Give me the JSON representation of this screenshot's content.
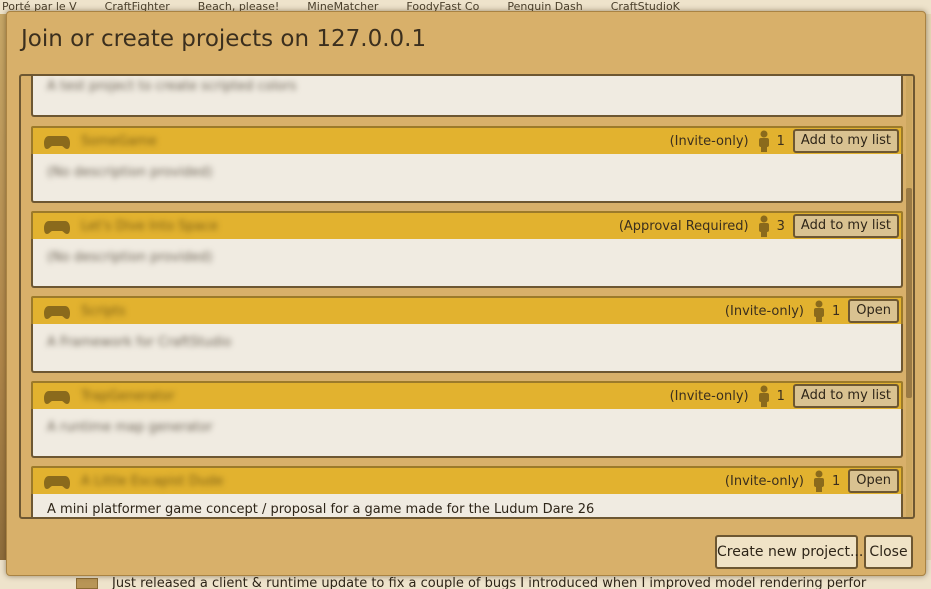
{
  "background": {
    "tabs": [
      "Porté par le V",
      "CraftFighter",
      "Beach, please!",
      "MineMatcher",
      "FoodyFast Co",
      "Penguin Dash",
      "CraftStudioK"
    ],
    "footer_text": "Just released a client & runtime update to fix a couple of bugs I introduced when I improved model rendering perfor"
  },
  "dialog": {
    "title": "Join or create projects on 127.0.0.1",
    "create_button": "Create new project...",
    "close_button": "Close"
  },
  "projects": [
    {
      "name": "",
      "description": "A test project to create scripted colors",
      "access": "",
      "members": "",
      "action": "",
      "partial": "top"
    },
    {
      "name": "SomeGame",
      "description": "(No description provided)",
      "access": "(Invite-only)",
      "members": "1",
      "action": "Add to my list"
    },
    {
      "name": "Let's Dive Into Space",
      "description": "(No description provided)",
      "access": "(Approval Required)",
      "members": "3",
      "action": "Add to my list"
    },
    {
      "name": "Scripts",
      "description": "A Framework for CraftStudio",
      "access": "(Invite-only)",
      "members": "1",
      "action": "Open"
    },
    {
      "name": "TrapGenerator",
      "description": "A runtime map generator",
      "access": "(Invite-only)",
      "members": "1",
      "action": "Add to my list"
    },
    {
      "name": "A Little Escapist Dude",
      "description": "A mini platformer game concept / proposal for a game made for the Ludum Dare 26",
      "access": "(Invite-only)",
      "members": "1",
      "action": "Open"
    }
  ],
  "colors": {
    "dialog_bg": "#d8b06a",
    "header_bg": "#e2b22f",
    "body_bg": "#f0ebe1",
    "border": "#6d5732"
  }
}
